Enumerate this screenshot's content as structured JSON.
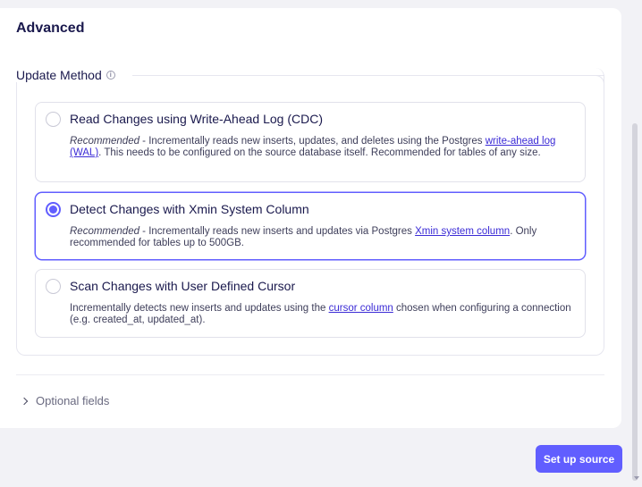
{
  "section": {
    "title": "Advanced"
  },
  "update_method": {
    "label": "Update Method",
    "info_icon": "ⓘ",
    "options": [
      {
        "title": "Read Changes using Write-Ahead Log (CDC)",
        "selected": false,
        "desc_prefix": "Recommended",
        "desc_text": " - Incrementally reads new inserts, updates, and deletes using the Postgres ",
        "link": "write-ahead log (WAL)",
        "desc_suffix": ". This needs to be configured on the source database itself. Recommended for tables of any size."
      },
      {
        "title": "Detect Changes with Xmin System Column",
        "selected": true,
        "desc_prefix": "Recommended",
        "desc_text": " - Incrementally reads new inserts and updates via Postgres ",
        "link": "Xmin system column",
        "desc_suffix": ". Only recommended for tables up to 500GB."
      },
      {
        "title": "Scan Changes with User Defined Cursor",
        "selected": false,
        "desc_prefix": "",
        "desc_text": "Incrementally detects new inserts and updates using the ",
        "link": "cursor column",
        "desc_suffix": " chosen when configuring a connection (e.g. created_at, updated_at)."
      }
    ]
  },
  "optional_fields": {
    "label": "Optional fields"
  },
  "actions": {
    "setup_label": "Set up source"
  },
  "colors": {
    "accent": "#615eff",
    "text": "#1a194d",
    "link": "#3b2bd6"
  },
  "icons": {
    "radio": "radio-icon",
    "info": "info-icon",
    "chevron": "chevron-right-icon"
  }
}
